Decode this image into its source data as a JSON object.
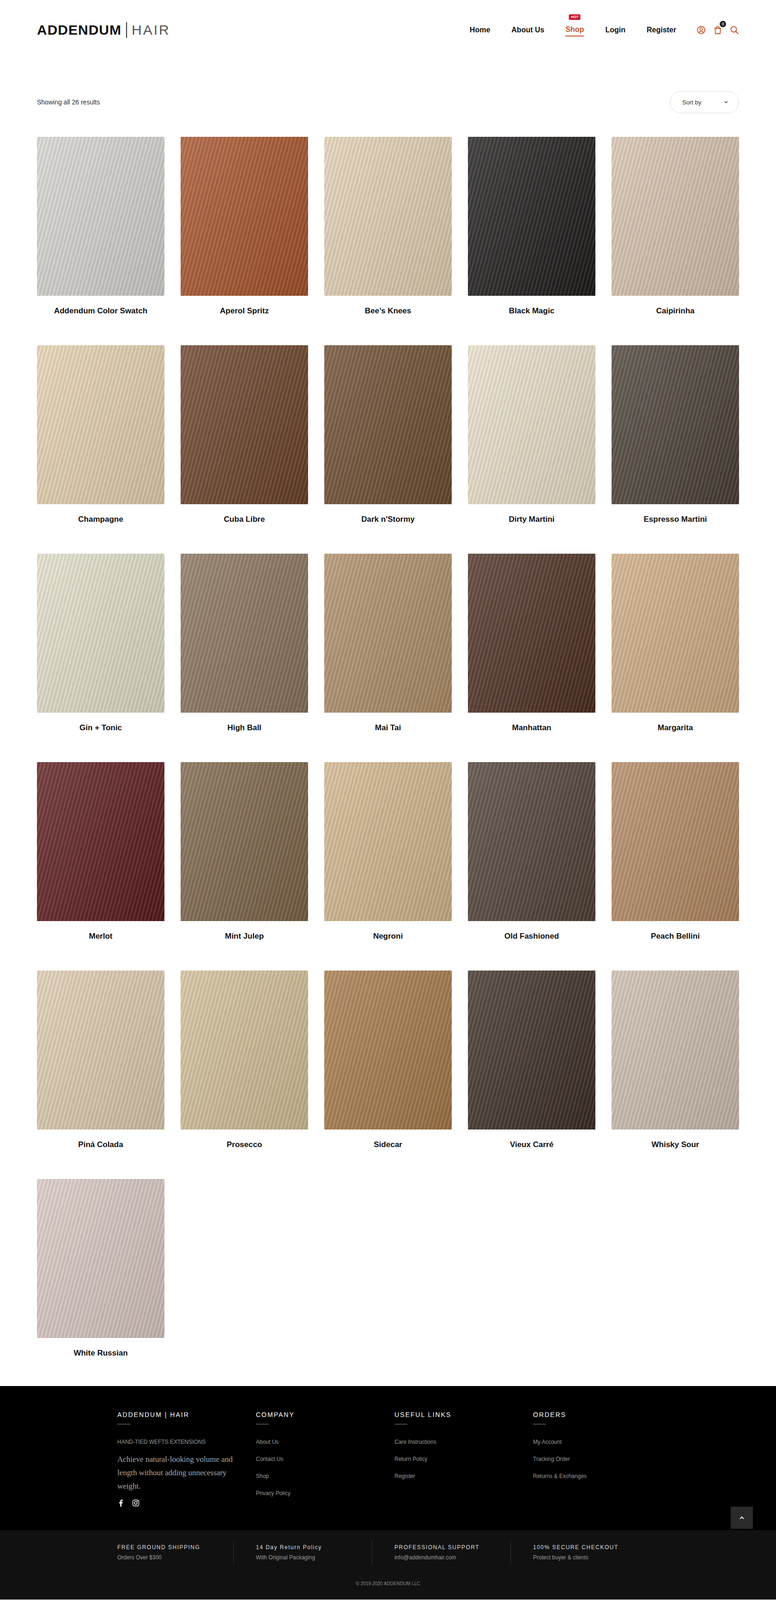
{
  "header": {
    "logo": {
      "brand": "ADDENDUM",
      "suffix": "HAIR"
    },
    "nav": [
      {
        "label": "Home",
        "selected": false
      },
      {
        "label": "About Us",
        "selected": false
      },
      {
        "label": "Shop",
        "selected": true,
        "badge": "HOT"
      },
      {
        "label": "Login",
        "selected": false
      },
      {
        "label": "Register",
        "selected": false
      }
    ],
    "cart_count": "0"
  },
  "toolbar": {
    "results": "Showing all 26 results",
    "sort": "Sort by"
  },
  "products": [
    {
      "name": "Addendum Color Swatch",
      "color": "#d8d6d2"
    },
    {
      "name": "Aperol Spritz",
      "color": "#a8532a"
    },
    {
      "name": "Bee’s Knees",
      "color": "#e6d2b5"
    },
    {
      "name": "Black Magic",
      "color": "#1e1c1b"
    },
    {
      "name": "Caipirinha",
      "color": "#d9c4b0"
    },
    {
      "name": "Champagne",
      "color": "#e8d3b0"
    },
    {
      "name": "Cuba Libre",
      "color": "#6b4127"
    },
    {
      "name": "Dark n'Stormy",
      "color": "#6e4c2f"
    },
    {
      "name": "Dirty Martini",
      "color": "#ece3cc"
    },
    {
      "name": "Espresso Martini",
      "color": "#4a4037"
    },
    {
      "name": "Gin + Tonic",
      "color": "#e4e1cb"
    },
    {
      "name": "High Ball",
      "color": "#8b735d"
    },
    {
      "name": "Mai Tai",
      "color": "#b08f69"
    },
    {
      "name": "Manhattan",
      "color": "#4d2e22"
    },
    {
      "name": "Margarita",
      "color": "#d1ae85"
    },
    {
      "name": "Merlot",
      "color": "#5c1a1c"
    },
    {
      "name": "Mint Julep",
      "color": "#7e6549"
    },
    {
      "name": "Negroni",
      "color": "#d4b88e"
    },
    {
      "name": "Old Fashioned",
      "color": "#4f4036"
    },
    {
      "name": "Peach Bellini",
      "color": "#b58a63"
    },
    {
      "name": "Piná Colada",
      "color": "#e0cdb1"
    },
    {
      "name": "Prosecco",
      "color": "#d5c199"
    },
    {
      "name": "Sidecar",
      "color": "#a77a4a"
    },
    {
      "name": "Vieux Carré",
      "color": "#3c2e25"
    },
    {
      "name": "Whisky Sour",
      "color": "#cfbfb0"
    },
    {
      "name": "White Russian",
      "color": "#dccac4"
    }
  ],
  "footer": {
    "brand": {
      "title": "ADDENDUM | HAIR",
      "tagline": "HAND-TIED WEFTS EXTENSIONS",
      "text": "Achieve natural-looking volume and length without adding unnecessary weight."
    },
    "columns": [
      {
        "title": "COMPANY",
        "links": [
          "About Us",
          "Contact Us",
          "Shop",
          "Privacy Policy"
        ]
      },
      {
        "title": "USEFUL LINKS",
        "links": [
          "Care Instructions",
          "Return Policy",
          "Register"
        ]
      },
      {
        "title": "ORDERS",
        "links": [
          "My Account",
          "Tracking Order",
          "Returns & Exchanges"
        ]
      }
    ],
    "features": [
      {
        "title": "FREE GROUND SHIPPING",
        "text": "Orders Over $300"
      },
      {
        "title": "14 Day Return Policy",
        "text": "With Original Packaging"
      },
      {
        "title": "PROFESSIONAL SUPPORT",
        "text": "info@addendumhair.com"
      },
      {
        "title": "100% SECURE CHECKOUT",
        "text": "Protect buyer & clients"
      }
    ],
    "copyright": "© 2019-2020 ADDENDUM LLC"
  }
}
